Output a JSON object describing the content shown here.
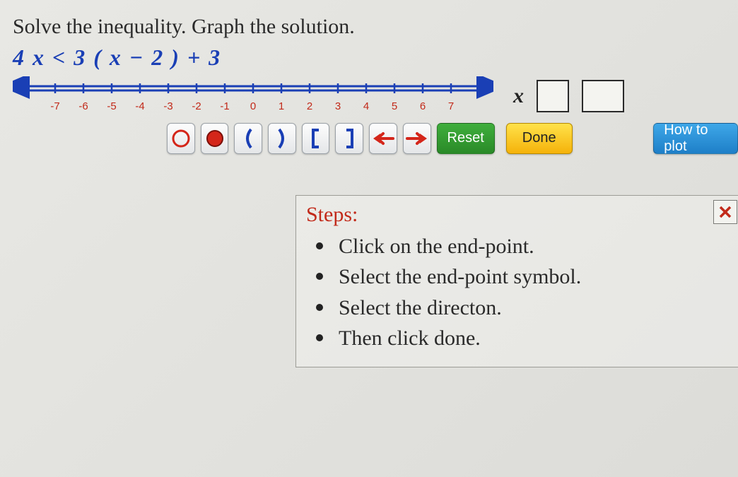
{
  "problem": {
    "instruction": "Solve the inequality. Graph the solution.",
    "inequality": "4 x   <   3  ( x  −  2 )  +  3"
  },
  "numline": {
    "ticks": [
      "-7",
      "-6",
      "-5",
      "-4",
      "-3",
      "-2",
      "-1",
      "0",
      "1",
      "2",
      "3",
      "4",
      "5",
      "6",
      "7"
    ]
  },
  "answer": {
    "var": "x"
  },
  "buttons": {
    "reset": "Reset",
    "done": "Done",
    "help": "How to plot"
  },
  "steps": {
    "title": "Steps:",
    "items": [
      "Click on the end-point.",
      "Select the end-point symbol.",
      "Select the directon.",
      "Then click done."
    ]
  }
}
